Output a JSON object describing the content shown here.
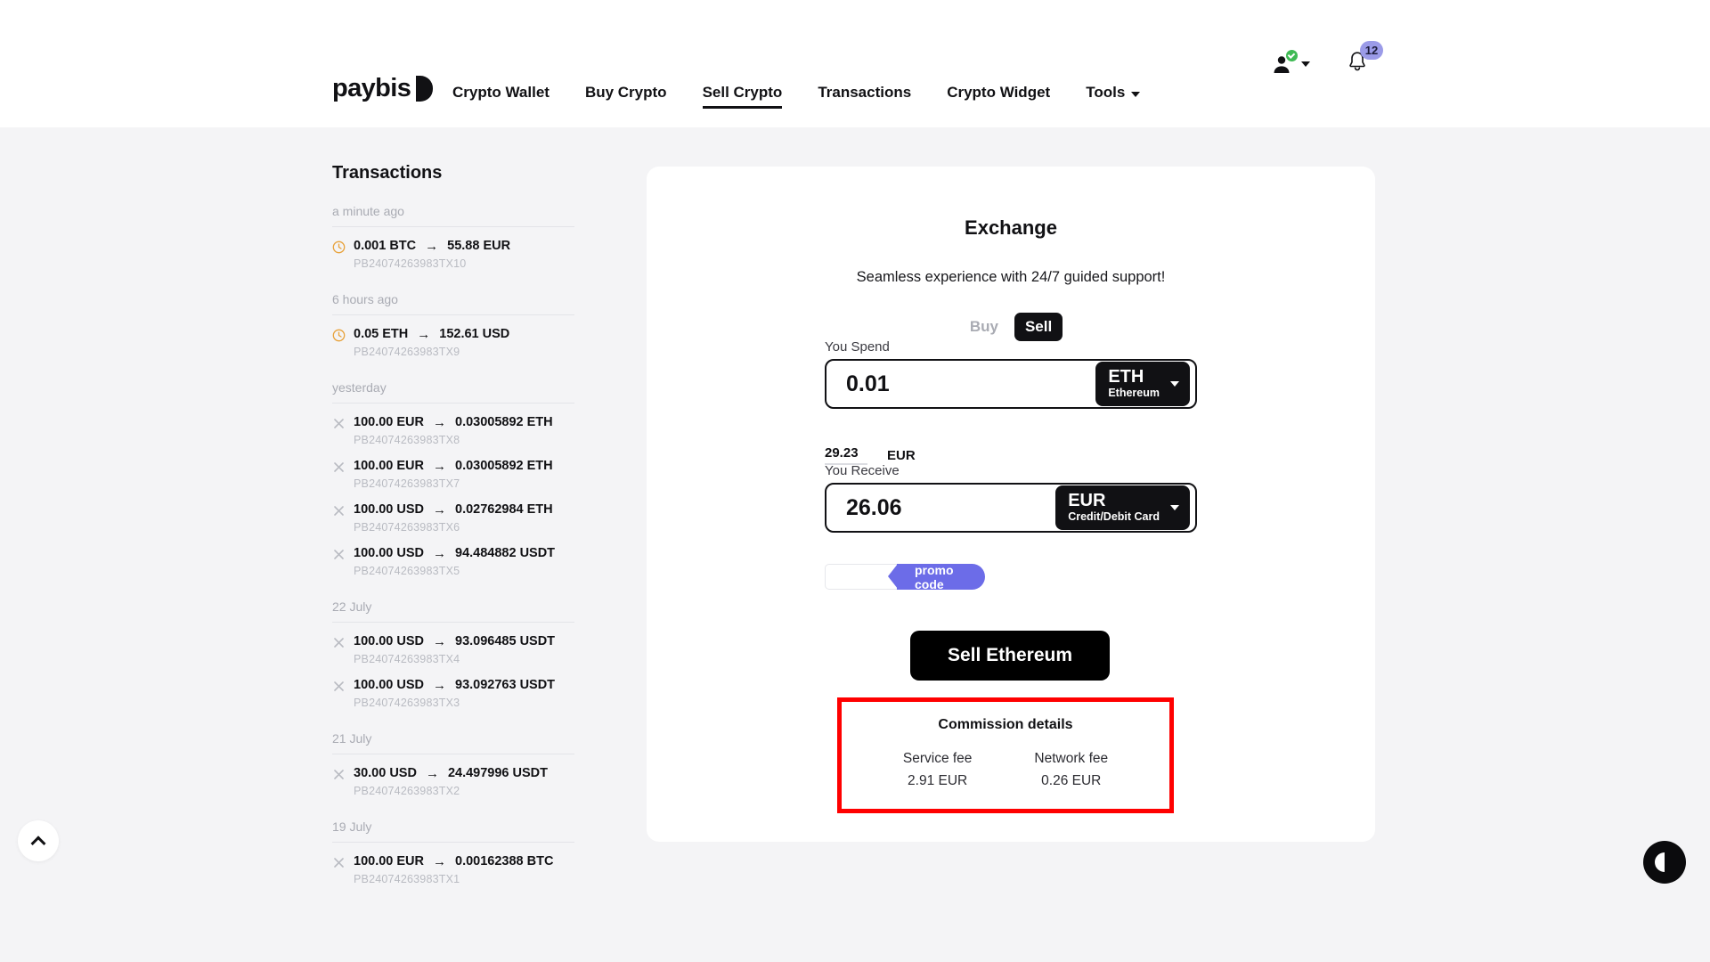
{
  "header": {
    "brand": {
      "word": "paybis",
      "mark_icon": "paybis-logo-mark"
    },
    "nav": [
      {
        "label": "Crypto Wallet",
        "active": false
      },
      {
        "label": "Buy Crypto",
        "active": false
      },
      {
        "label": "Sell Crypto",
        "active": true
      },
      {
        "label": "Transactions",
        "active": false
      },
      {
        "label": "Crypto Widget",
        "active": false
      },
      {
        "label": "Tools",
        "active": false,
        "has_caret": true
      }
    ],
    "account": {
      "icon": "user-verified-icon",
      "caret_icon": "chevron-down-icon"
    },
    "notifications": {
      "icon": "bell-icon",
      "count": "12",
      "badge_color": "#9b9be8"
    }
  },
  "sidebar": {
    "title": "Transactions",
    "groups": [
      {
        "label": "a minute ago",
        "items": [
          {
            "status_icon": "clock-icon",
            "from": "0.001 BTC",
            "arrow": "→",
            "to": "55.88 EUR",
            "id": "PB24074263983TX10"
          }
        ]
      },
      {
        "label": "6 hours ago",
        "items": [
          {
            "status_icon": "clock-icon",
            "from": "0.05 ETH",
            "arrow": "→",
            "to": "152.61 USD",
            "id": "PB24074263983TX9"
          }
        ]
      },
      {
        "label": "yesterday",
        "items": [
          {
            "status_icon": "cancel-icon",
            "from": "100.00 EUR",
            "arrow": "→",
            "to": "0.03005892 ETH",
            "id": "PB24074263983TX8"
          },
          {
            "status_icon": "cancel-icon",
            "from": "100.00 EUR",
            "arrow": "→",
            "to": "0.03005892 ETH",
            "id": "PB24074263983TX7"
          },
          {
            "status_icon": "cancel-icon",
            "from": "100.00 USD",
            "arrow": "→",
            "to": "0.02762984 ETH",
            "id": "PB24074263983TX6"
          },
          {
            "status_icon": "cancel-icon",
            "from": "100.00 USD",
            "arrow": "→",
            "to": "94.484882 USDT",
            "id": "PB24074263983TX5"
          }
        ]
      },
      {
        "label": "22 July",
        "items": [
          {
            "status_icon": "cancel-icon",
            "from": "100.00 USD",
            "arrow": "→",
            "to": "93.096485 USDT",
            "id": "PB24074263983TX4"
          },
          {
            "status_icon": "cancel-icon",
            "from": "100.00 USD",
            "arrow": "→",
            "to": "93.092763 USDT",
            "id": "PB24074263983TX3"
          }
        ]
      },
      {
        "label": "21 July",
        "items": [
          {
            "status_icon": "cancel-icon",
            "from": "30.00 USD",
            "arrow": "→",
            "to": "24.497996 USDT",
            "id": "PB24074263983TX2"
          }
        ]
      },
      {
        "label": "19 July",
        "items": [
          {
            "status_icon": "cancel-icon",
            "from": "100.00 EUR",
            "arrow": "→",
            "to": "0.00162388 BTC",
            "id": "PB24074263983TX1"
          }
        ]
      }
    ]
  },
  "exchange": {
    "title": "Exchange",
    "subtitle": "Seamless experience with 24/7 guided support!",
    "mode": {
      "buy_label": "Buy",
      "sell_label": "Sell",
      "selected": "Sell"
    },
    "spend": {
      "label": "You Spend",
      "value": "0.01",
      "currency_code": "ETH",
      "currency_name": "Ethereum"
    },
    "rate": {
      "value": "29.23",
      "currency": "EUR"
    },
    "receive": {
      "label": "You Receive",
      "value": "26.06",
      "currency_code": "EUR",
      "currency_name": "Credit/Debit Card"
    },
    "promo": {
      "placeholder": "",
      "value": "",
      "chip_label": "promo code",
      "chip_color": "#6c6ce8"
    },
    "submit_label": "Sell Ethereum",
    "commission": {
      "title": "Commission details",
      "highlight_color": "#ff0000",
      "fees": [
        {
          "label": "Service fee",
          "value": "2.91 EUR"
        },
        {
          "label": "Network fee",
          "value": "0.26 EUR"
        }
      ]
    }
  },
  "floating": {
    "scroll_top_icon": "chevron-up-icon",
    "contrast_icon": "contrast-toggle-icon"
  }
}
